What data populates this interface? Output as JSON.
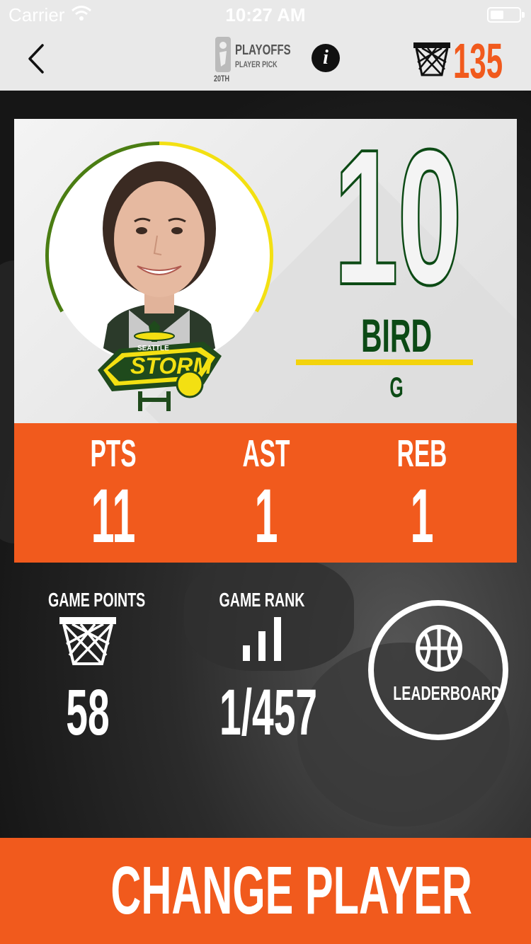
{
  "status_bar": {
    "carrier": "Carrier",
    "time": "10:27 AM"
  },
  "nav": {
    "logo_title": "PLAYOFFS",
    "logo_subtitle": "PLAYER PICK",
    "logo_badge": "20TH",
    "info_icon": "info-icon",
    "total_points": "135"
  },
  "player": {
    "number": "10",
    "last_name": "BIRD",
    "position": "G",
    "team_logo_text": "STORM",
    "team_logo_sub": "SEATTLE",
    "ring_colors": [
      "#4a7d12",
      "#f3e012"
    ]
  },
  "stats": [
    {
      "label": "PTS",
      "value": "11"
    },
    {
      "label": "AST",
      "value": "1"
    },
    {
      "label": "REB",
      "value": "1"
    }
  ],
  "game": {
    "points_label": "GAME POINTS",
    "points_value": "58",
    "rank_label": "GAME RANK",
    "rank_value": "1/457",
    "leaderboard_label": "LEADERBOARD"
  },
  "actions": {
    "change_player": "CHANGE PLAYER"
  },
  "colors": {
    "accent": "#f15a1d",
    "team_green": "#0c4a15",
    "team_yellow": "#f3d30c"
  }
}
